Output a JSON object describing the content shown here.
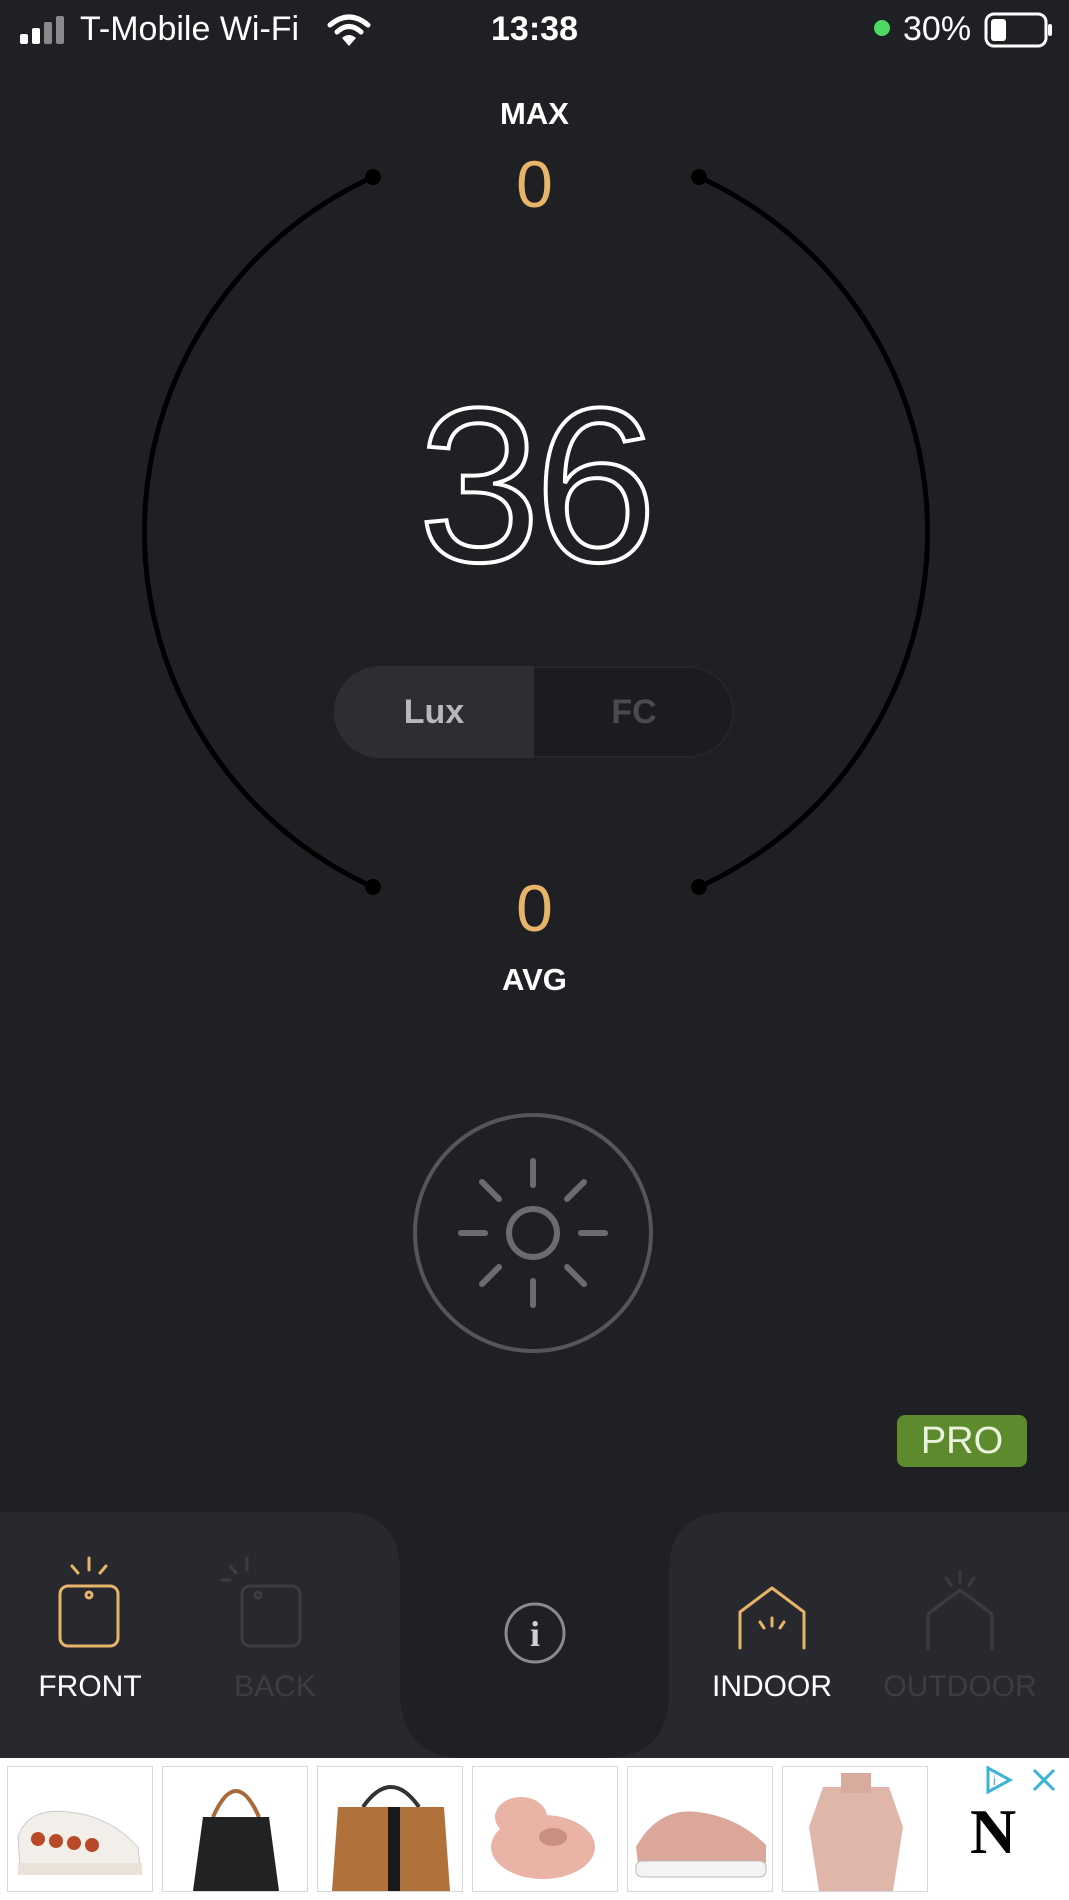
{
  "status_bar": {
    "carrier": "T-Mobile Wi-Fi",
    "time": "13:38",
    "battery_percent": "30%",
    "battery_level": 0.3
  },
  "meter": {
    "max_label": "MAX",
    "max_value": "0",
    "reading": "36",
    "avg_value": "0",
    "avg_label": "AVG",
    "units": [
      {
        "label": "Lux",
        "active": true
      },
      {
        "label": "FC",
        "active": false
      }
    ]
  },
  "pro_badge": "PRO",
  "camera": {
    "front_label": "FRONT",
    "back_label": "BACK",
    "selected": "FRONT"
  },
  "environment": {
    "indoor_label": "INDOOR",
    "outdoor_label": "OUTDOOR",
    "selected": "INDOOR"
  },
  "ad": {
    "brand_letter": "N",
    "items": [
      "sneaker-heart",
      "black-tote",
      "brown-tote",
      "pink-slipper",
      "pink-running-shoe",
      "pink-sweater"
    ]
  },
  "colors": {
    "background": "#1f2024",
    "accent": "#e8b46a",
    "pro": "#5e8a2e"
  }
}
